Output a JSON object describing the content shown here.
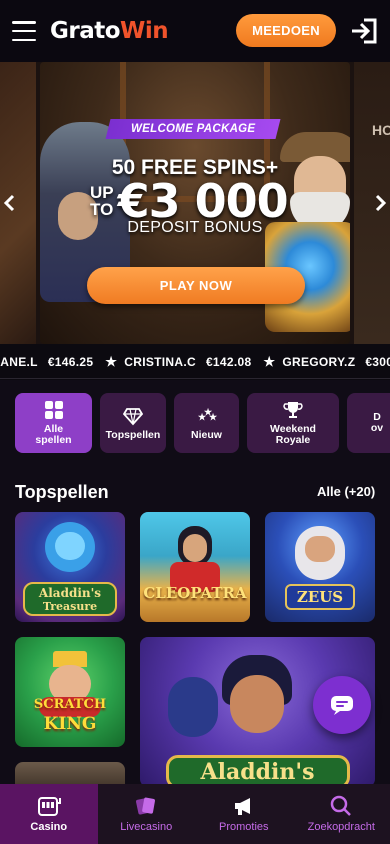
{
  "header": {
    "logo_part1": "Grato",
    "logo_part2": "Win",
    "join_label": "MEEDOEN"
  },
  "banner": {
    "ribbon": "WELCOME PACKAGE",
    "line1": "50 FREE SPINS+",
    "upto_1": "UP",
    "upto_2": "TO",
    "amount": "€3 000",
    "line3": "DEPOSIT BONUS",
    "cta": "PLAY NOW",
    "next_slide_peek": "HO"
  },
  "ticker": [
    {
      "name": "XANE.L",
      "amount": "€146.25"
    },
    {
      "name": "CRISTINA.C",
      "amount": "€142.08"
    },
    {
      "name": "GREGORY.Z",
      "amount": "€300"
    }
  ],
  "categories": [
    {
      "label_1": "Alle",
      "label_2": "spellen",
      "icon": "grid-icon",
      "active": true
    },
    {
      "label_1": "Topspellen",
      "label_2": "",
      "icon": "diamond-icon",
      "active": false
    },
    {
      "label_1": "Nieuw",
      "label_2": "",
      "icon": "stars-icon",
      "active": false
    },
    {
      "label_1": "Weekend",
      "label_2": "Royale",
      "icon": "trophy-icon",
      "active": false
    },
    {
      "label_1": "D",
      "label_2": "ov",
      "icon": "dice-icon",
      "active": false
    }
  ],
  "section": {
    "title": "Topspellen",
    "all_label": "Alle (+20)"
  },
  "games": [
    {
      "label_1": "Aladdin's",
      "label_2": "Treasure"
    },
    {
      "label_1": "CLEOPATRA",
      "label_2": ""
    },
    {
      "label_1": "ZEUS",
      "label_2": ""
    },
    {
      "label_1": "SCRATCH",
      "label_2": "KING"
    },
    {
      "label_1": "Aladdin's",
      "label_2": ""
    }
  ],
  "bottom_nav": [
    {
      "label": "Casino",
      "icon": "slot-machine-icon",
      "active": true
    },
    {
      "label": "Livecasino",
      "icon": "cards-icon",
      "active": false
    },
    {
      "label": "Promoties",
      "icon": "megaphone-icon",
      "active": false
    },
    {
      "label": "Zoekopdracht",
      "icon": "search-icon",
      "active": false
    }
  ],
  "colors": {
    "accent_orange": "#f58a2b",
    "accent_purple": "#8e3fc7",
    "nav_active": "#5a1462"
  }
}
